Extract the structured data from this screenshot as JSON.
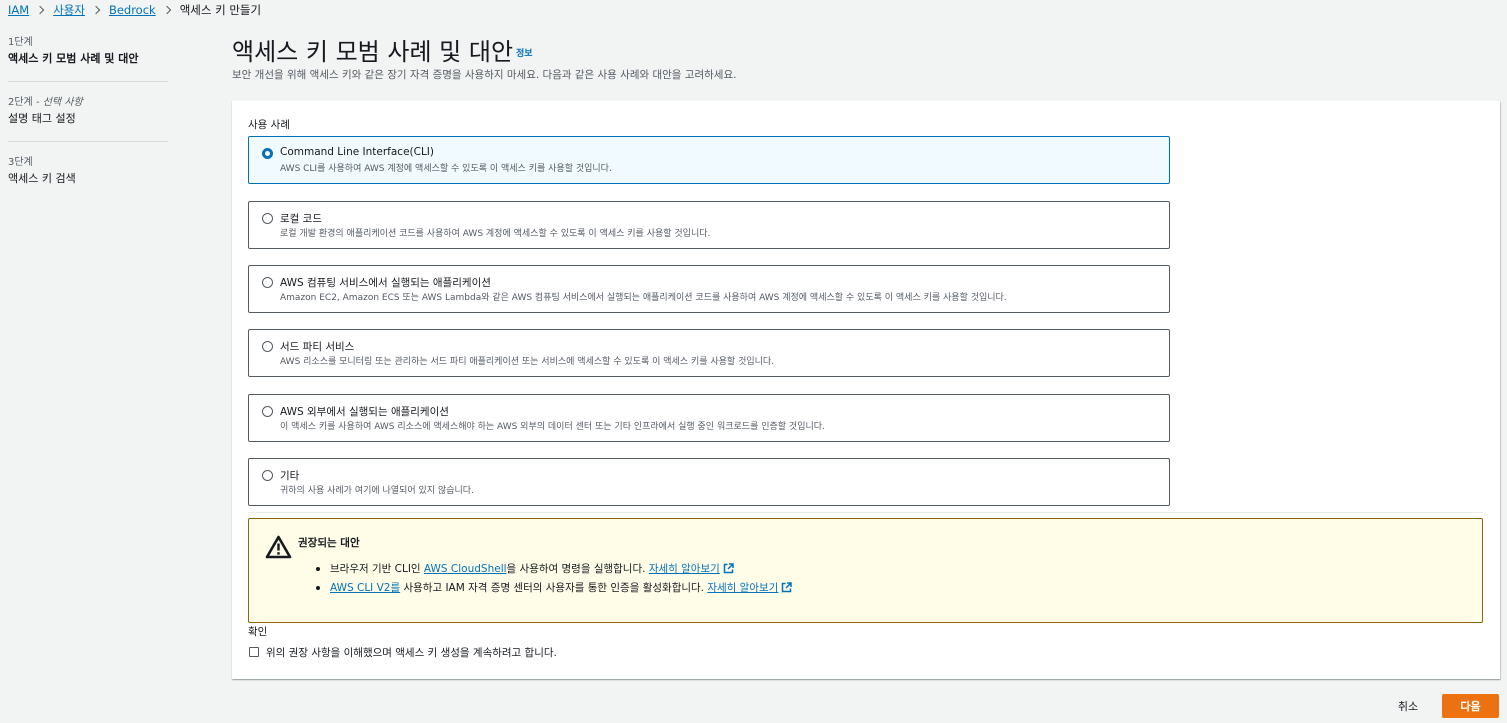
{
  "breadcrumb": {
    "items": [
      "IAM",
      "사용자",
      "Bedrock"
    ],
    "current": "액세스 키 만들기"
  },
  "steps": [
    {
      "label": "1단계",
      "title": "액세스 키 모범 사례 및 대안"
    },
    {
      "label": "2단계 - ",
      "optional": "선택 사항",
      "title": "설명 태그 설정"
    },
    {
      "label": "3단계",
      "title": "액세스 키 검색"
    }
  ],
  "header": {
    "title": "액세스 키 모범 사례 및 대안",
    "info": "정보",
    "description": "보안 개선을 위해 액세스 키와 같은 장기 자격 증명을 사용하지 마세요. 다음과 같은 사용 사례와 대안을 고려하세요."
  },
  "use_case": {
    "label": "사용 사례",
    "options": [
      {
        "title": "Command Line Interface(CLI)",
        "desc": "AWS CLI를 사용하여 AWS 계정에 액세스할 수 있도록 이 액세스 키를 사용할 것입니다."
      },
      {
        "title": "로컬 코드",
        "desc": "로컬 개발 환경의 애플리케이션 코드를 사용하여 AWS 계정에 액세스할 수 있도록 이 액세스 키를 사용할 것입니다."
      },
      {
        "title": "AWS 컴퓨팅 서비스에서 실행되는 애플리케이션",
        "desc": "Amazon EC2, Amazon ECS 또는 AWS Lambda와 같은 AWS 컴퓨팅 서비스에서 실행되는 애플리케이션 코드를 사용하여 AWS 계정에 액세스할 수 있도록 이 액세스 키를 사용할 것입니다."
      },
      {
        "title": "서드 파티 서비스",
        "desc": "AWS 리소스를 모니터링 또는 관리하는 서드 파티 애플리케이션 또는 서비스에 액세스할 수 있도록 이 액세스 키를 사용할 것입니다."
      },
      {
        "title": "AWS 외부에서 실행되는 애플리케이션",
        "desc": "이 액세스 키를 사용하여 AWS 리소스에 액세스해야 하는 AWS 외부의 데이터 센터 또는 기타 인프라에서 실행 중인 워크로드를 인증할 것입니다."
      },
      {
        "title": "기타",
        "desc": "귀하의 사용 사례가 여기에 나열되어 있지 않습니다."
      }
    ]
  },
  "alert": {
    "title": "권장되는 대안",
    "item1": {
      "pre": "브라우저 기반 CLI인 ",
      "link": "AWS CloudShell",
      "post": "을 사용하여 명령을 실행합니다. ",
      "learn": "자세히 알아보기"
    },
    "item2": {
      "link": "AWS CLI V2를",
      "post": " 사용하고 IAM 자격 증명 센터의 사용자를 통한 인증을 활성화합니다. ",
      "learn": "자세히 알아보기"
    }
  },
  "confirm": {
    "label": "확인",
    "text": "위의 권장 사항을 이해했으며 액세스 키 생성을 계속하려고 합니다."
  },
  "footer": {
    "cancel": "취소",
    "next": "다음"
  },
  "colors": {
    "link": "#0073bb",
    "primary_button": "#ec7211",
    "alert_bg": "#fffce7",
    "alert_border": "#8d6605"
  }
}
